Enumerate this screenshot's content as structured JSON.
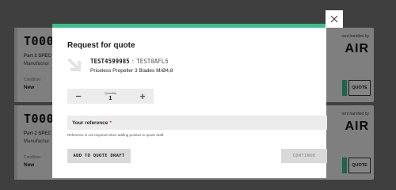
{
  "background": {
    "cards": [
      {
        "code": "T000",
        "part": "Part 2 SPEC",
        "manufacturer": "Manufactur",
        "condition_label": "Condition",
        "condition_value": "New",
        "handled_by": "rent handled by",
        "brand": "AIR",
        "quote_label": "QUOTE"
      },
      {
        "code": "T000",
        "part": "Part 2 SPEC",
        "manufacturer": "Manufactur",
        "condition_label": "Condition",
        "condition_value": "New",
        "handled_by": "rent handled by",
        "brand": "AIR",
        "quote_label": "QUOTE"
      }
    ]
  },
  "modal": {
    "title": "Request for quote",
    "product": {
      "code": "TEST4599985",
      "separator": ":",
      "alt_code": "TEST0AFL5",
      "name": "Priceless Propeller 3 Blades M/Ø4,8",
      "icon": "arrow-down-right-icon"
    },
    "quantity": {
      "label": "Quantity",
      "value": "1",
      "decrement": "−",
      "increment": "+"
    },
    "reference": {
      "label": "Your reference",
      "required_mark": "*",
      "value": "",
      "hint": "Reference is not required when adding product to quote draft"
    },
    "buttons": {
      "add_draft": "ADD TO QUOTE DRAFT",
      "continue": "CONTINUE"
    },
    "close_icon": "close-icon"
  },
  "colors": {
    "accent": "#36c08e",
    "required": "#e03030",
    "field_bg": "#ececec",
    "button_bg": "#d9d9d9"
  }
}
